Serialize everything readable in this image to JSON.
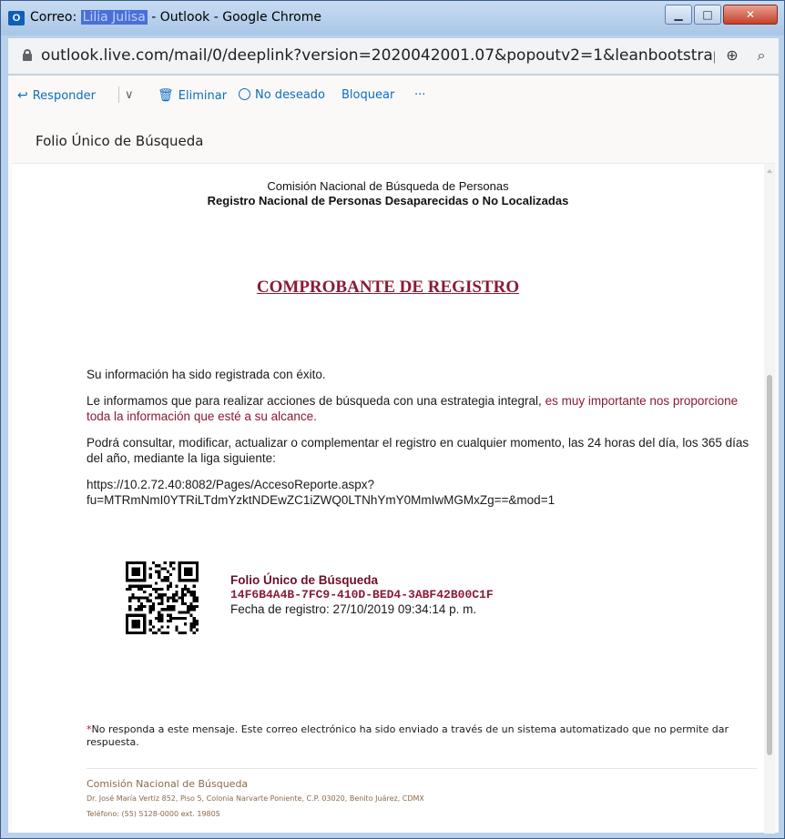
{
  "window": {
    "title_prefix": "Correo: ",
    "title_redacted": "Lilia Julisa",
    "title_suffix": " - Outlook - Google Chrome",
    "app_icon": "O",
    "min_icon": "▁",
    "max_icon": "□",
    "close_icon": "✕"
  },
  "address_bar": {
    "url": "outlook.live.com/mail/0/deeplink?version=2020042001.07&popoutv2=1&leanbootstrap=1",
    "zoom_icon": "⊕",
    "search_icon": "⌕"
  },
  "toolbar": {
    "reply_icon": "↩",
    "reply_label": "Responder",
    "dropdown_icon": "∨",
    "delete_icon": "🗑",
    "delete_label": "Eliminar",
    "junk_icon": "⃠",
    "junk_label": "No deseado",
    "block_label": "Bloquear",
    "more_label": "···"
  },
  "message": {
    "subject": "Folio Único de Búsqueda",
    "header_line1": "Comisión Nacional de Búsqueda de Personas",
    "header_line2": "Registro Nacional de Personas Desaparecidas o No Localizadas",
    "receipt_title": "COMPROBANTE DE REGISTRO",
    "para1": "Su información ha sido registrada con éxito.",
    "para2_plain": "Le informamos que para realizar acciones de búsqueda con una estrategia integral, ",
    "para2_highlight": "es muy importante nos proporcione toda la información que esté a su alcance.",
    "para3": "Podrá consultar, modificar, actualizar o complementar el registro en cualquier momento, las 24 horas del día, los 365 días del año, mediante la liga siguiente:",
    "link_line1": "https://10.2.72.40:8082/Pages/AccesoReporte.aspx?",
    "link_line2": "fu=MTRmNmI0YTRiLTdmYzktNDEwZC1iZWQ0LTNhYmY0MmIwMGMxZg==&mod=1",
    "folio_title": "Folio Único de Búsqueda",
    "folio_id": "14F6B4A4B-7FC9-410D-BED4-3ABF42B00C1F",
    "folio_date": "Fecha de registro: 27/10/2019 09:34:14 p. m.",
    "note_asterisk": "*",
    "note_text": "No responda a este mensaje. Este correo electrónico ha sido enviado a través de un sistema automatizado que no permite dar respuesta.",
    "footer_org": "Comisión Nacional de Búsqueda",
    "footer_address": "Dr. José María Vertiz 852, Piso 5, Colonia Narvarte Poniente, C.P. 03020, Benito Juárez, CDMX",
    "footer_phone": "Teléfono: (55) 5128-0000 ext. 19805"
  }
}
